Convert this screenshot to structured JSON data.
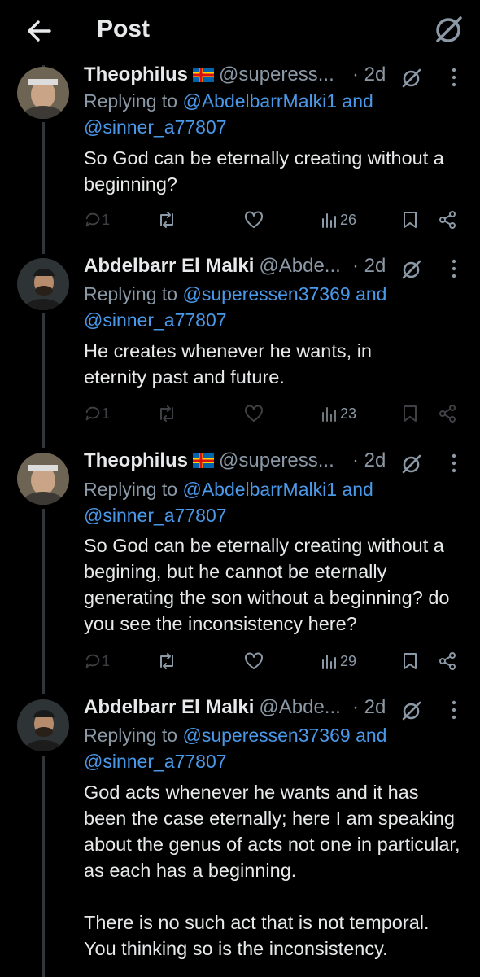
{
  "header": {
    "title": "Post"
  },
  "posts": [
    {
      "name": "Theophilus",
      "flag": "aland-flag",
      "handle": "@superess...",
      "time": "· 2d",
      "reply_prefix": "Replying to ",
      "reply_user1": "@AbdelbarrMalki1",
      "reply_and": " and",
      "reply_user2": "@sinner_a77807",
      "text": "So God can be eternally creating without a beginning?",
      "replies": "1",
      "views": "26"
    },
    {
      "name": "Abdelbarr El Malki",
      "handle": "@Abde...",
      "time": "· 2d",
      "reply_prefix": "Replying to ",
      "reply_user1": "@superessen37369",
      "reply_and": " and",
      "reply_user2": "@sinner_a77807",
      "text": "He creates whenever he wants, in eternity past and future.",
      "replies": "1",
      "views": "23"
    },
    {
      "name": "Theophilus",
      "flag": "aland-flag",
      "handle": "@superess...",
      "time": "· 2d",
      "reply_prefix": "Replying to ",
      "reply_user1": "@AbdelbarrMalki1",
      "reply_and": " and",
      "reply_user2": "@sinner_a77807",
      "text": "So God can be eternally creating without a begining, but he cannot be eternally generating the son without a beginning? do you see the inconsistency here?",
      "replies": "1",
      "views": "29"
    },
    {
      "name": "Abdelbarr El Malki",
      "handle": "@Abde...",
      "time": "· 2d",
      "reply_prefix": "Replying to ",
      "reply_user1": "@superessen37369",
      "reply_and": " and",
      "reply_user2": "@sinner_a77807",
      "text": "God acts whenever he wants and it has been the case eternally; here I am speaking about the genus of acts not one in particular, as each has a beginning.\n\nThere is no such act that is not temporal. You thinking so is the inconsistency."
    }
  ],
  "colors": {
    "background": "#000000",
    "text": "#e7e9ea",
    "muted": "#8b98a5",
    "link": "#4a99e9",
    "divider": "#2f3336"
  }
}
